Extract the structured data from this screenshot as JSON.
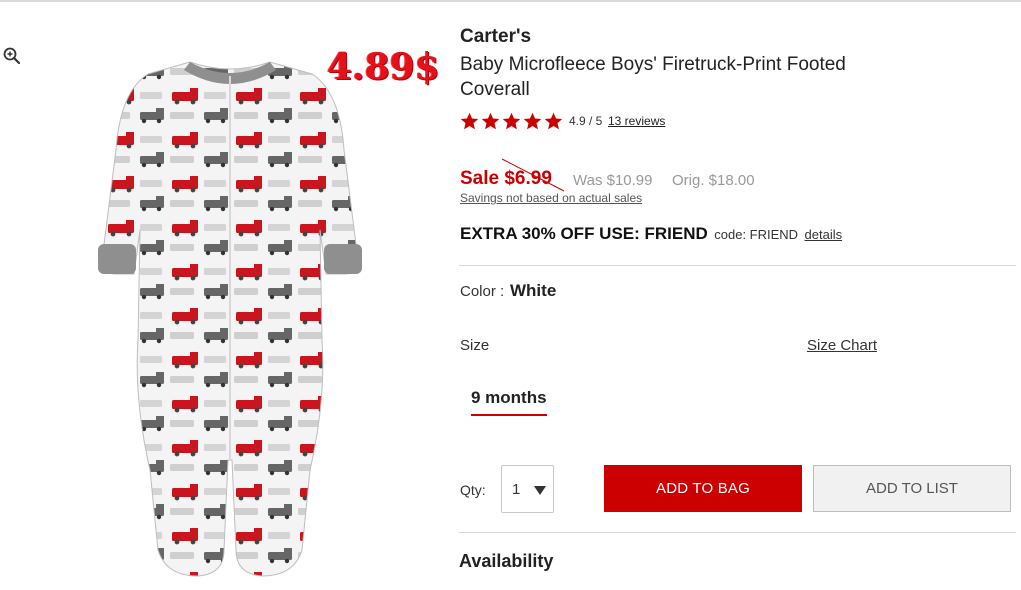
{
  "sticker": {
    "price": "4.89$"
  },
  "product": {
    "brand": "Carter's",
    "title": "Baby Microfleece Boys' Firetruck-Print Footed Coverall",
    "rating_value": 4.9,
    "rating_text": "4.9 / 5",
    "reviews_link": "13 reviews"
  },
  "pricing": {
    "sale": "Sale $6.99",
    "was": "Was $10.99",
    "orig": "Orig. $18.00",
    "savings_note": "Savings not based on actual sales"
  },
  "promo": {
    "text": "EXTRA 30% OFF USE: FRIEND",
    "code": "code: FRIEND",
    "details": "details"
  },
  "color": {
    "label": "Color :",
    "value": "White"
  },
  "size": {
    "label": "Size",
    "chart_link": "Size Chart",
    "selected": "9 months"
  },
  "quantity": {
    "label": "Qty:",
    "value": "1"
  },
  "actions": {
    "add_to_bag": "ADD TO BAG",
    "add_to_list": "ADD TO LIST"
  },
  "availability": {
    "heading": "Availability"
  },
  "colors": {
    "accent_red": "#cc0000",
    "sticker_red": "#e4101a",
    "muted_gray": "#999999"
  },
  "icons": {
    "zoom": "zoom-in-icon",
    "star": "star-icon",
    "caret": "chevron-down-icon"
  }
}
